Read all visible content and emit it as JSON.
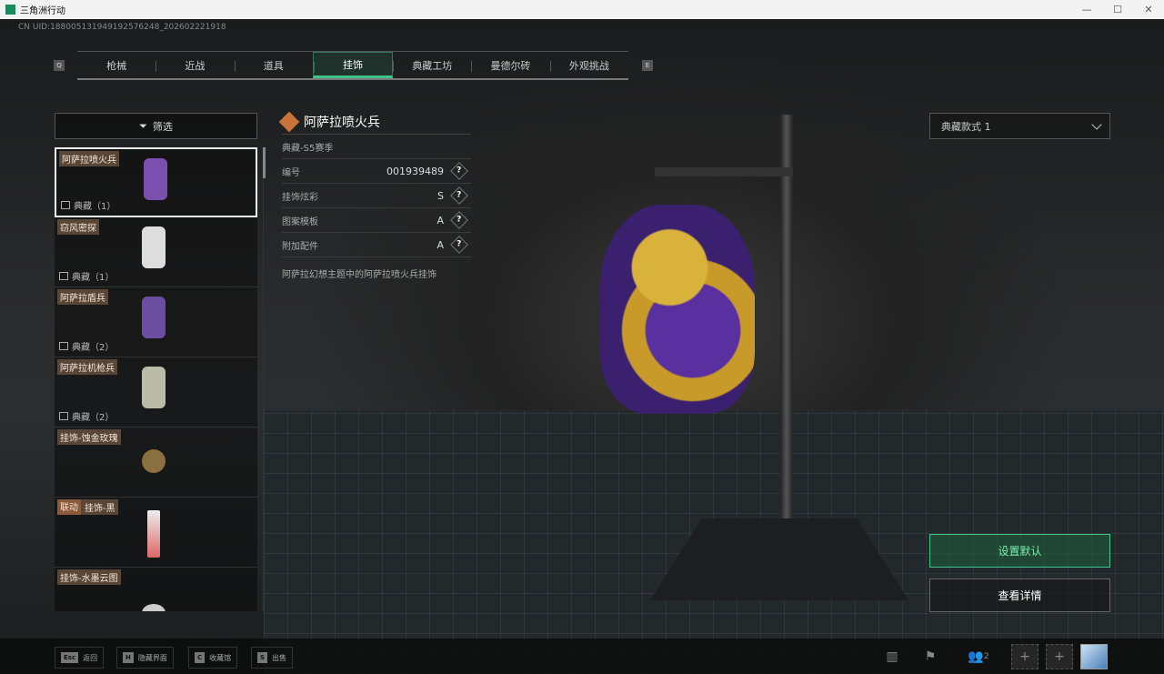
{
  "window": {
    "title": "三角洲行动",
    "controls": [
      "—",
      "☐",
      "✕"
    ]
  },
  "uid": "CN UID:188005131949192576248_202602221918",
  "tabs": {
    "prev_key": "Q",
    "next_key": "E",
    "items": [
      "枪械",
      "近战",
      "道具",
      "挂饰",
      "典藏工坊",
      "曼德尔砖",
      "外观挑战"
    ],
    "active": 3
  },
  "filter_label": "筛选",
  "list": [
    {
      "name": "阿萨拉喷火兵",
      "count": "典藏（1）",
      "color": "#7a4fb0"
    },
    {
      "name": "窃风密探",
      "count": "典藏（1）",
      "color": "#ddd"
    },
    {
      "name": "阿萨拉盾兵",
      "count": "典藏（2）",
      "color": "#6a4fa0"
    },
    {
      "name": "阿萨拉机枪兵",
      "count": "典藏（2）",
      "color": "#bba"
    },
    {
      "name": "挂饰-蚀金玫瑰",
      "color": "#8a7040"
    },
    {
      "name": "挂饰-黑",
      "badge": "联动",
      "color": "#d66"
    },
    {
      "name": "挂饰-水墨云图",
      "color": "#ccc"
    }
  ],
  "detail": {
    "title": "阿萨拉喷火兵",
    "season": "典藏-S5赛季",
    "rows": [
      {
        "label": "编号",
        "value": "001939489"
      },
      {
        "label": "挂饰炫彩",
        "value": "S"
      },
      {
        "label": "图案模板",
        "value": "A"
      },
      {
        "label": "附加配件",
        "value": "A"
      }
    ],
    "help": "?",
    "description": "阿萨拉幻想主题中的阿萨拉喷火兵挂饰"
  },
  "style_select": "典藏款式 1",
  "buttons": {
    "set_default": "设置默认",
    "view_details": "查看详情"
  },
  "hotkeys": [
    {
      "key": "Esc",
      "label": "返回"
    },
    {
      "key": "H",
      "label": "隐藏界面"
    },
    {
      "key": "C",
      "label": "收藏馆"
    },
    {
      "key": "S",
      "label": "出售"
    }
  ],
  "bottom_icons": {
    "stats": "▥",
    "flag": "⚑",
    "friends": "👥",
    "friends_count": "2",
    "plus": "+"
  }
}
